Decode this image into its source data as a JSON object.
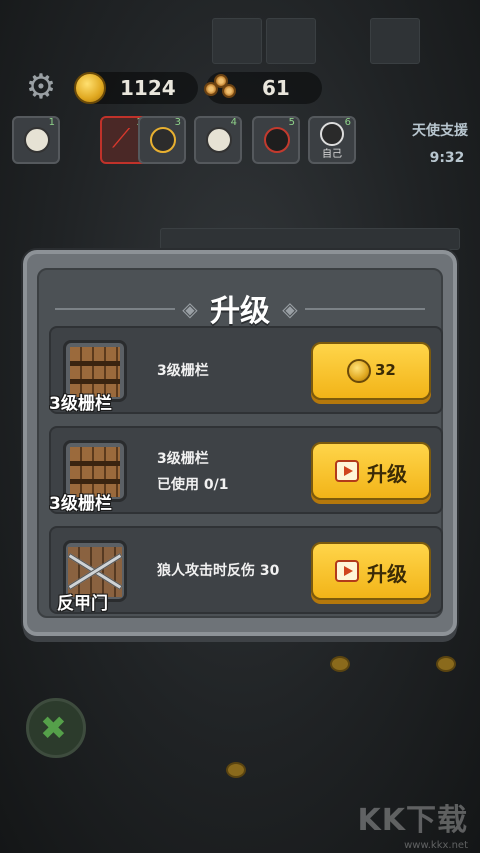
{
  "hud": {
    "gold": "1124",
    "wood": "61",
    "icons": [
      "gear-icon",
      "coin-icon",
      "wood-logs-icon"
    ]
  },
  "team": {
    "slots": [
      {
        "num": "1",
        "label": ""
      },
      {
        "num": "2",
        "label": ""
      },
      {
        "num": "3",
        "label": ""
      },
      {
        "num": "4",
        "label": ""
      },
      {
        "num": "5",
        "label": ""
      },
      {
        "num": "6",
        "label": "自己"
      }
    ]
  },
  "angel": {
    "title": "天使支援",
    "timer": "9:32"
  },
  "dialog": {
    "title": "升级",
    "rows": [
      {
        "icon_label": "3级栅栏",
        "line1": "3级栅栏",
        "line2": "",
        "button_price": "32",
        "button_label": ""
      },
      {
        "icon_label": "3级栅栏",
        "line1": "3级栅栏",
        "line2": "已使用 0/1",
        "button_price": "",
        "button_label": "升级"
      },
      {
        "icon_label": "反甲门",
        "line1": "狼人攻击时反伤 30",
        "line2": "",
        "button_price": "",
        "button_label": "升级"
      }
    ]
  },
  "watermark": {
    "text": "KK下载",
    "url": "www.kkx.net"
  },
  "colors": {
    "button": "#f2b418",
    "panel": "#6e7378",
    "selected_slot": "#c0322a"
  }
}
